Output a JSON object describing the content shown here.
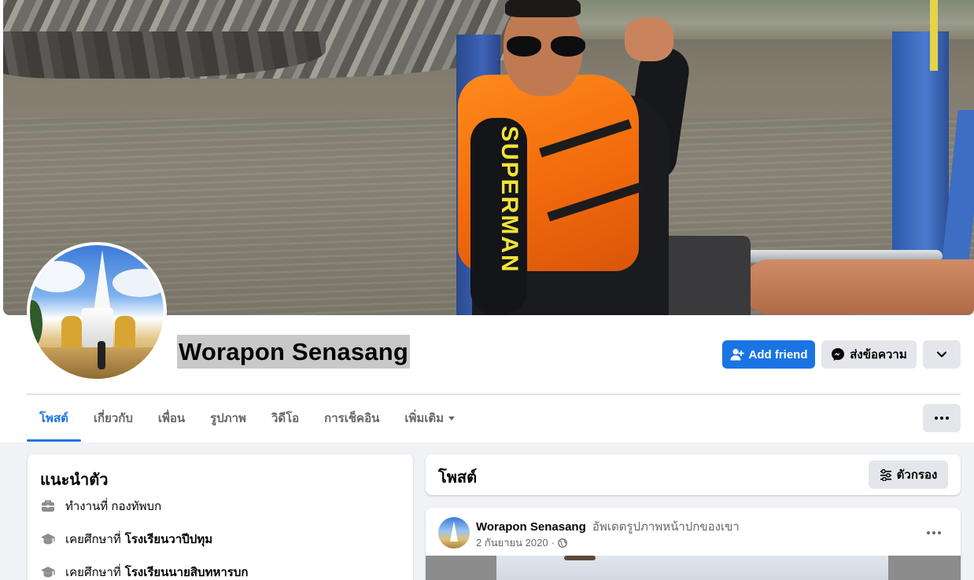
{
  "profile": {
    "name": "Worapon Senasang"
  },
  "actions": {
    "add_friend": "Add friend",
    "message": "ส่งข้อความ"
  },
  "tabs": [
    {
      "label": "โพสต์"
    },
    {
      "label": "เกี่ยวกับ"
    },
    {
      "label": "เพื่อน"
    },
    {
      "label": "รูปภาพ"
    },
    {
      "label": "วิดีโอ"
    },
    {
      "label": "การเช็คอิน"
    },
    {
      "label": "เพิ่มเติม"
    }
  ],
  "intro": {
    "title": "แนะนำตัว",
    "items": [
      {
        "icon": "briefcase-icon",
        "prefix": "ทำงานที่ กองทัพบก",
        "bold": ""
      },
      {
        "icon": "graduation-cap-icon",
        "prefix": "เคยศึกษาที่",
        "bold": "โรงเรียนวาปีปทุม"
      },
      {
        "icon": "graduation-cap-icon",
        "prefix": "เคยศึกษาที่",
        "bold": "โรงเรียนนายสิบทหารบก"
      }
    ]
  },
  "posts": {
    "title": "โพสต์",
    "filter_label": "ตัวกรอง",
    "first_post": {
      "author": "Worapon Senasang",
      "action": "อัพเดตรูปภาพหน้าปกของเขา",
      "date": "2 กันยายน 2020",
      "separator": "·"
    }
  },
  "colors": {
    "primary": "#1b74e4",
    "gray_button": "#e4e6eb",
    "secondary_text": "#65676b",
    "page_bg": "#f0f2f5"
  }
}
